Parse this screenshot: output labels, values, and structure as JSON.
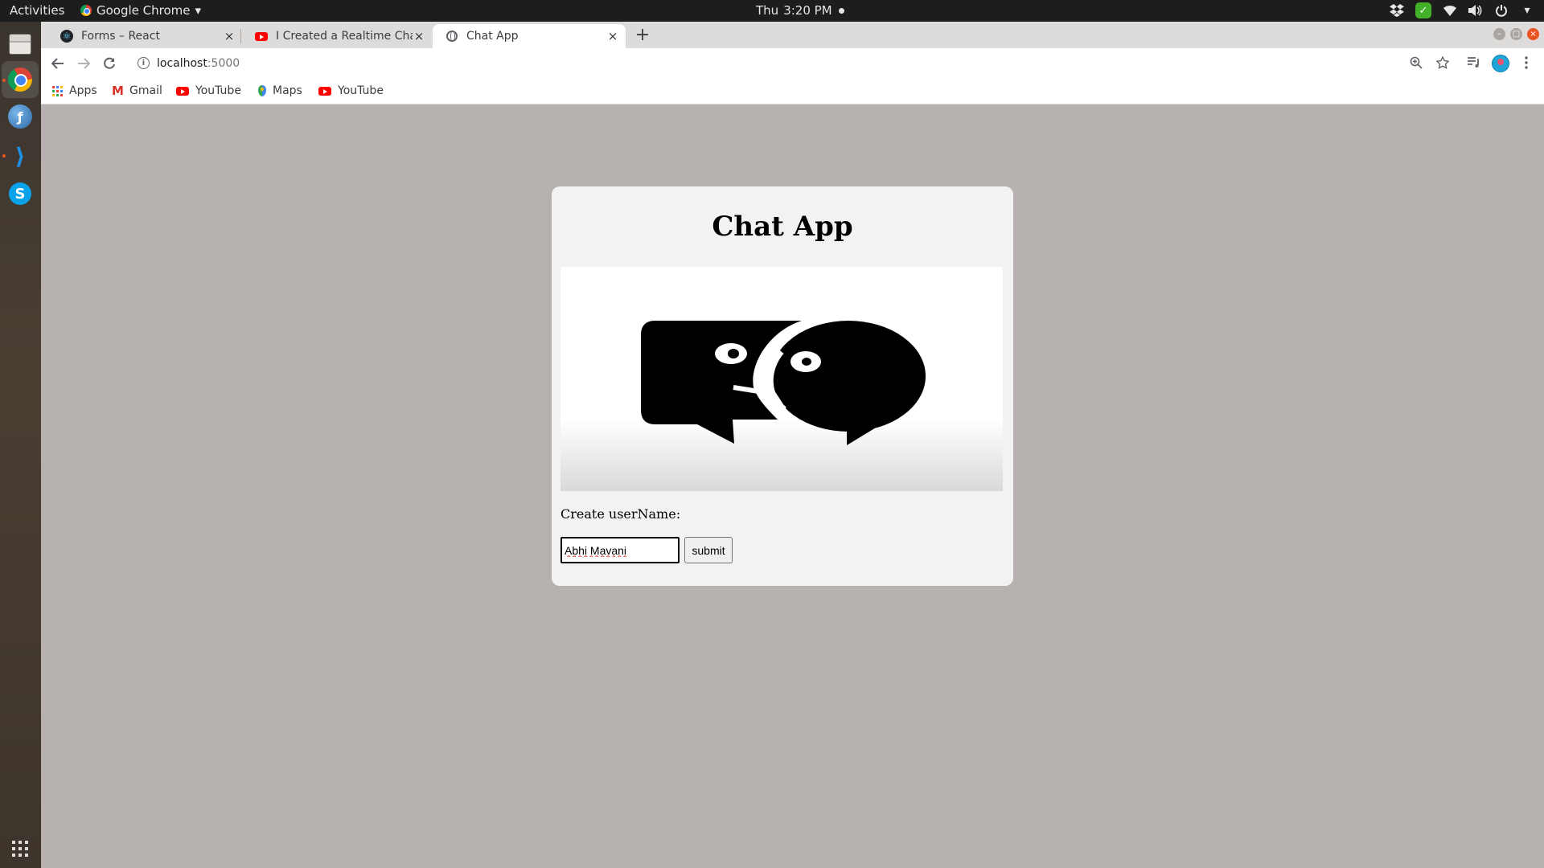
{
  "system": {
    "activities_label": "Activities",
    "app_menu_label": "Google Chrome",
    "app_menu_arrow": "▾",
    "clock_day": "Thu",
    "clock_time": "3:20 PM"
  },
  "dock": {
    "items": [
      "files",
      "google-chrome",
      "filezilla",
      "vscode",
      "skype",
      "show-applications"
    ]
  },
  "browser": {
    "tabs": [
      {
        "title": "Forms – React",
        "favicon": "react-icon"
      },
      {
        "title": "I Created a Realtime Chat",
        "favicon": "youtube-icon"
      },
      {
        "title": "Chat App",
        "favicon": "globe-icon",
        "active": true
      }
    ],
    "new_tab_label": "+",
    "close_glyph": "×",
    "url_host": "localhost",
    "url_port": ":5000",
    "bookmarks": [
      {
        "label": "Apps",
        "icon": "apps-grid-icon"
      },
      {
        "label": "Gmail",
        "icon": "gmail-icon"
      },
      {
        "label": "YouTube",
        "icon": "youtube-icon"
      },
      {
        "label": "Maps",
        "icon": "maps-icon"
      },
      {
        "label": "YouTube",
        "icon": "youtube-icon"
      }
    ]
  },
  "page": {
    "title": "Chat App",
    "hero_image": "chat-bubbles-illustration",
    "username_label": "Create userName:",
    "username_value": "Abhi Mavani",
    "submit_label": "submit"
  },
  "colors": {
    "page_background": "#b7b2b0",
    "card_background": "#f2f2f2",
    "ubuntu_accent": "#e95420"
  }
}
